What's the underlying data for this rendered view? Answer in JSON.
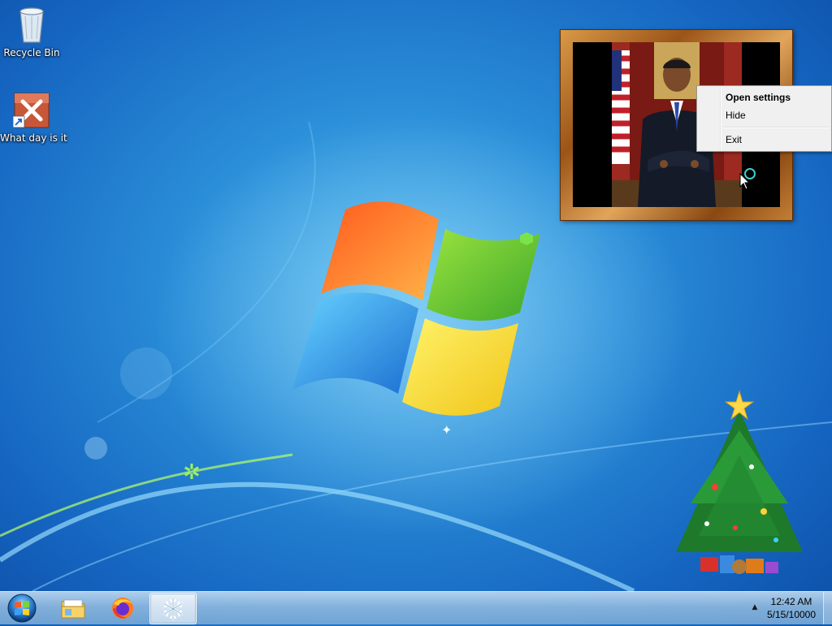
{
  "desktop": {
    "icons": [
      {
        "label": "Recycle Bin",
        "icon": "recycle-bin-icon"
      },
      {
        "label": "What day is it",
        "icon": "what-day-app-icon"
      }
    ]
  },
  "photo_frame": {
    "subject": "portrait-photo"
  },
  "context_menu": {
    "items": [
      {
        "label": "Open settings",
        "default": true
      },
      {
        "label": "Hide"
      },
      {
        "label": "Exit"
      }
    ]
  },
  "taskbar": {
    "start_icon": "windows-start-orb-icon",
    "pinned": [
      {
        "icon": "file-explorer-icon"
      },
      {
        "icon": "firefox-icon"
      },
      {
        "icon": "snowflake-icon",
        "active": true
      }
    ],
    "tray_arrow": "▲",
    "clock": {
      "time": "12:42 AM",
      "date": "5/15/10000"
    }
  },
  "colors": {
    "wallpaper_blue": "#1e7dd6",
    "frame_wood": "#b06a25",
    "menu_bg": "#f0f0f0"
  }
}
